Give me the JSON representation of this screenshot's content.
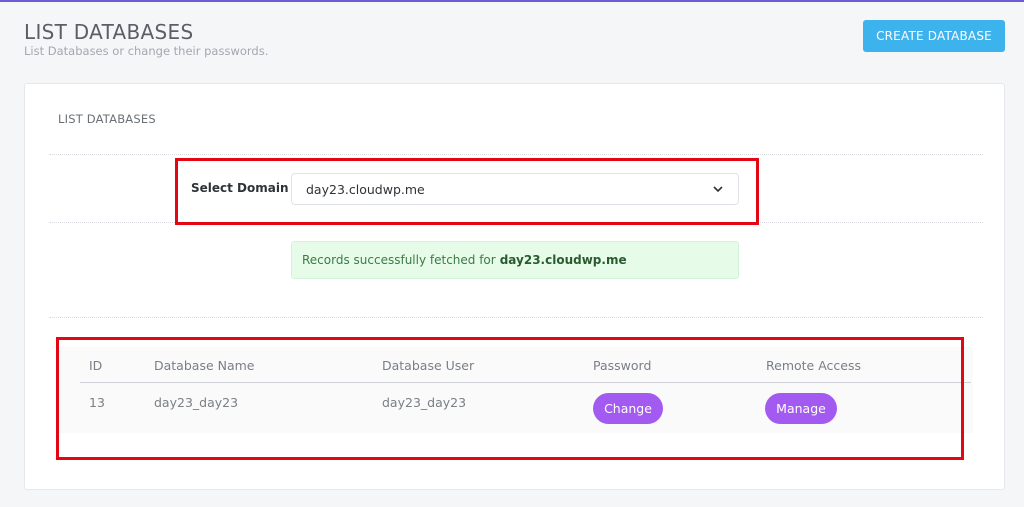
{
  "header": {
    "title": "LIST DATABASES",
    "subtitle": "List Databases or change their passwords.",
    "create_button": "CREATE DATABASE"
  },
  "card": {
    "title": "LIST DATABASES",
    "domain_label": "Select Domain",
    "domain_value": "day23.cloudwp.me",
    "alert_text": "Records successfully fetched for",
    "alert_domain": "day23.cloudwp.me"
  },
  "table": {
    "columns": [
      "ID",
      "Database Name",
      "Database User",
      "Password",
      "Remote Access"
    ],
    "rows": [
      {
        "id": "13",
        "database_name": "day23_day23",
        "database_user": "day23_day23",
        "password_button": "Change",
        "remote_button": "Manage"
      }
    ]
  },
  "colors": {
    "accent_button": "#3db3ee",
    "action_pill": "#a35af0",
    "alert_bg": "#e7fbe9",
    "highlight_box": "#e30613"
  },
  "icons": {
    "select_chevron": "chevron-down-icon"
  }
}
